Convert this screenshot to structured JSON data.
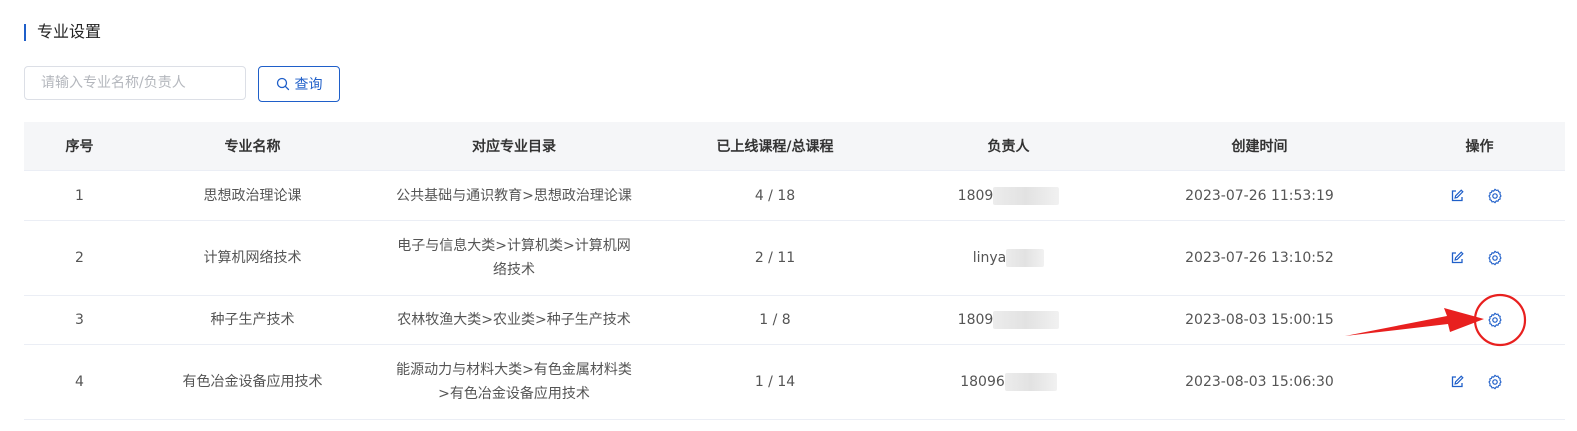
{
  "header": {
    "title": "专业设置"
  },
  "search": {
    "placeholder": "请输入专业名称/负责人",
    "value": "",
    "button_label": "查询",
    "button_icon": "search-icon"
  },
  "table": {
    "columns": [
      "序号",
      "专业名称",
      "对应专业目录",
      "已上线课程/总课程",
      "负责人",
      "创建时间",
      "操作"
    ],
    "rows": [
      {
        "index": "1",
        "name": "思想政治理论课",
        "catalog_line1": "公共基础与通识教育>思想政治理论课",
        "catalog_line2": "",
        "courses": "4 / 18",
        "owner": "1809",
        "created": "2023-07-26 11:53:19"
      },
      {
        "index": "2",
        "name": "计算机网络技术",
        "catalog_line1": "电子与信息大类>计算机类>计算机网",
        "catalog_line2": "络技术",
        "courses": "2 / 11",
        "owner": "linya",
        "created": "2023-07-26 13:10:52"
      },
      {
        "index": "3",
        "name": "种子生产技术",
        "catalog_line1": "农林牧渔大类>农业类>种子生产技术",
        "catalog_line2": "",
        "courses": "1 / 8",
        "owner": "1809",
        "created": "2023-08-03 15:00:15"
      },
      {
        "index": "4",
        "name": "有色冶金设备应用技术",
        "catalog_line1": "能源动力与材料大类>有色金属材料类",
        "catalog_line2": ">有色冶金设备应用技术",
        "courses": "1 / 14",
        "owner": "18096",
        "created": "2023-08-03 15:06:30"
      }
    ],
    "action_icons": [
      "edit-icon",
      "settings-icon"
    ]
  },
  "colors": {
    "accent": "#1f5fc9",
    "header_bg": "#f5f6f8",
    "annotation_red": "#e8201f"
  }
}
